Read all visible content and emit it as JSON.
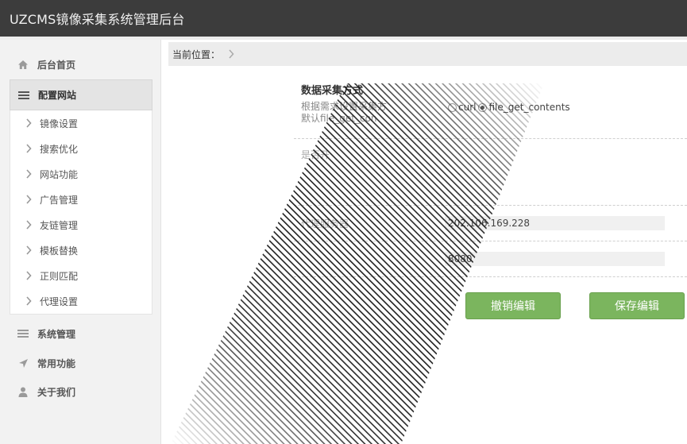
{
  "app": {
    "title": "UZCMS镜像采集系统管理后台"
  },
  "sidebar": {
    "items": [
      {
        "label": "后台首页",
        "icon": "home-icon"
      },
      {
        "label": "配置网站",
        "icon": "menu-lines-icon"
      },
      {
        "label": "系统管理",
        "icon": "menu-lines-icon"
      },
      {
        "label": "常用功能",
        "icon": "location-arrow-icon"
      },
      {
        "label": "关于我们",
        "icon": "user-icon"
      }
    ],
    "submenu": [
      {
        "label": "镜像设置"
      },
      {
        "label": "搜索优化"
      },
      {
        "label": "网站功能"
      },
      {
        "label": "广告管理"
      },
      {
        "label": "友链管理"
      },
      {
        "label": "模板替换"
      },
      {
        "label": "正则匹配"
      },
      {
        "label": "代理设置"
      }
    ]
  },
  "breadcrumb": {
    "label": "当前位置："
  },
  "form": {
    "collect_title": "数据采集方式",
    "collect_desc_line1": "根据需求设置采集方",
    "collect_desc_line2": "默认file_get_con",
    "option_curl": "curl",
    "option_fgc": "file_get_contents",
    "proxy_enable_label": "是否开",
    "proxy_server_label": "代理服务器",
    "proxy_server_value": "202.106.169.228",
    "proxy_port_value": "8080",
    "cancel_button": "撤销编辑",
    "save_button": "保存编辑"
  },
  "colors": {
    "accent_green": "#7bb55e",
    "topbar": "#3c3c3c"
  }
}
